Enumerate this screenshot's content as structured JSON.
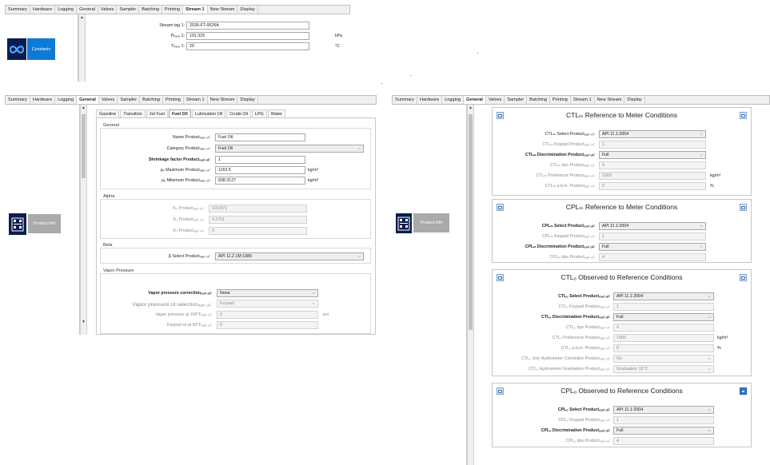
{
  "top": {
    "tabs": [
      "Summary",
      "Hardware",
      "Logging",
      "General",
      "Valves",
      "Sampler",
      "Batching",
      "Printing",
      "Stream 1",
      "New Stream",
      "Display"
    ],
    "active_tab": "Stream 1",
    "constants_label": "Constants",
    "fields": [
      {
        "label": "Stream tag 1:",
        "value": "2036-FT-0526A",
        "unit": ""
      },
      {
        "label": "Pₕₐₛₑ 1:",
        "value": "101.325",
        "unit": "kPa"
      },
      {
        "label": "Tₕₐₛₑ 1:",
        "value": "20",
        "unit": "°C"
      }
    ]
  },
  "left": {
    "tabs": [
      "Summary",
      "Hardware",
      "Logging",
      "General",
      "Valves",
      "Sampler",
      "Batching",
      "Printing",
      "Stream 1",
      "New Stream",
      "Display"
    ],
    "active_tab": "General",
    "product_info_label": "Product Info",
    "subtabs": [
      "Gasoline",
      "Transition",
      "Jet Fuel",
      "Fuel Oil",
      "Lubrication Oil",
      "Crude Oil",
      "LPG",
      "Water"
    ],
    "active_subtab": "Fuel Oil",
    "general": {
      "title": "General",
      "name_label": "Name Productₓₐₑₗ ₒᵢₗ:",
      "name_value": "Fuel Oil",
      "category_label": "Category Productₓₐₑₗ ₒᵢₗ:",
      "category_value": "Fuel Oil",
      "shrinkage_label": "Shrinkage factor Productₓₐₑₗ ₒᵢₗ:",
      "shrinkage_value": "1",
      "max_label": "ρₑ Maximum Productₓₐₑₗ ₒᵢₗ:",
      "max_value": "1163.5",
      "max_unit": "kg/m³",
      "min_label": "ρₑ Minimum Productₓₐₑₗ ₒᵢₗ:",
      "min_value": "838.3127",
      "min_unit": "kg/m³"
    },
    "alpha": {
      "title": "Alpha",
      "rows": [
        {
          "label": "K₀ Productₓₐₑₗ ₒᵢₗ:",
          "value": "103.872"
        },
        {
          "label": "K₁ Productₓₐₑₗ ₒᵢₗ:",
          "value": "0.2701"
        },
        {
          "label": "K₂ Productₓₐₑₗ ₒᵢₗ:",
          "value": "0"
        }
      ]
    },
    "beta": {
      "title": "Beta",
      "select_label": "β Select Productₓₐₑₗ ₒᵢₗ:",
      "select_value": "API 11.2.1M:1985"
    },
    "vapor": {
      "title": "Vapor Pressure",
      "correction_label": "Vapor pressure correctionₓₐₑₗ ₒᵢₗ:",
      "correction_value": "None",
      "rd_label": "Vapor pressure rd selectionₓₐₑₗ ₒᵢₗ:",
      "rd_value": "Keypad",
      "at100_label": "Vapor pressure at 100°Fₓₐₑₗ ₒᵢₗ:",
      "at100_value": "0",
      "at100_unit": "psi",
      "keypad_label": "Keypad rd at 60°Fₓₐₑₗ ₒᵢₗ:",
      "keypad_value": "0"
    }
  },
  "right": {
    "tabs": [
      "Summary",
      "Hardware",
      "Logging",
      "General",
      "Valves",
      "Sampler",
      "Batching",
      "Printing",
      "Stream 1",
      "New Stream",
      "Display"
    ],
    "active_tab": "General",
    "product_info_label": "Product Info",
    "cards": [
      {
        "title": "CTLₘ Reference to Meter Conditions",
        "rows": [
          {
            "label": "CTLₘ Select Productₓₐₑₗ ₒᵢₗ:",
            "value": "API 11.1:2004",
            "kind": "dd",
            "style": "normal",
            "unit": ""
          },
          {
            "label": "CTLₘ Keypad Productₓₐₑₗ ₒᵢₗ:",
            "value": "1",
            "kind": "fld",
            "style": "dim",
            "unit": ""
          },
          {
            "label": "CTLₘ Discrimination Productₓₐₑₗ ₒᵢₗ:",
            "value": "Full",
            "kind": "dd",
            "style": "bold",
            "unit": ""
          },
          {
            "label": "CTLₘ dps Productₓₐₑₗ ₒᵢₗ:",
            "value": "4",
            "kind": "fld",
            "style": "dim",
            "unit": ""
          },
          {
            "label": "CTLₘ Preference Productₓₐₑₗ ₒᵢₗ:",
            "value": "1000",
            "kind": "fld",
            "style": "dim",
            "unit": "kg/m³"
          },
          {
            "label": "CTLₘ a.b.m. Productₓₐₑₗ ₒᵢₗ:",
            "value": "0",
            "kind": "fld",
            "style": "dim",
            "unit": "%"
          }
        ]
      },
      {
        "title": "CPLₘ Reference to Meter Conditions",
        "rows": [
          {
            "label": "CPLₘ Select Productₓₐₑₗ ₒᵢₗ:",
            "value": "API 11.1:2004",
            "kind": "dd",
            "style": "bold",
            "unit": ""
          },
          {
            "label": "CPLₘ Keypad Productₓₐₑₗ ₒᵢₗ:",
            "value": "1",
            "kind": "fld",
            "style": "dim",
            "unit": ""
          },
          {
            "label": "CPLₘ Discrimination Productₓₐₑₗ ₒᵢₗ:",
            "value": "Full",
            "kind": "dd",
            "style": "bold",
            "unit": ""
          },
          {
            "label": "CPLₘ dps Productₓₐₑₗ ₒᵢₗ:",
            "value": "4",
            "kind": "fld",
            "style": "dim",
            "unit": ""
          }
        ]
      },
      {
        "title": "CTLₒ Observed to Reference Conditions",
        "rows": [
          {
            "label": "CTLₒ Select Productₓₐₑₗ ₒᵢₗ:",
            "value": "API 11.1:2004",
            "kind": "dd",
            "style": "bold",
            "unit": ""
          },
          {
            "label": "CTLₒ Keypad Productₓₐₑₗ ₒᵢₗ:",
            "value": "1",
            "kind": "fld",
            "style": "dim",
            "unit": ""
          },
          {
            "label": "CTLₒ Discrimination Productₓₐₑₗ ₒᵢₗ:",
            "value": "Full",
            "kind": "dd",
            "style": "bold",
            "unit": ""
          },
          {
            "label": "CTLₒ dps Productₓₐₑₗ ₒᵢₗ:",
            "value": "4",
            "kind": "fld",
            "style": "dim",
            "unit": ""
          },
          {
            "label": "CTLₒ Preference Productₓₐₑₗ ₒᵢₗ:",
            "value": "1000",
            "kind": "fld",
            "style": "dim",
            "unit": "kg/m³"
          },
          {
            "label": "CTLₒ a.b.m. Productₓₐₑₗ ₒᵢₗ:",
            "value": "0",
            "kind": "fld",
            "style": "dim",
            "unit": "%"
          },
          {
            "label": "CTLₒ Use Hydrometer Correction Productₓₐₑₗ ₒᵢₗ:",
            "value": "No",
            "kind": "dd",
            "style": "dim",
            "unit": ""
          },
          {
            "label": "CTLₒ Hydrometer Graduation Productₓₐₑₗ ₒᵢₗ:",
            "value": "Graduation 15°C",
            "kind": "dd",
            "style": "dim",
            "unit": ""
          }
        ]
      },
      {
        "title": "CPLₒ Observed to Reference Conditions",
        "rows": [
          {
            "label": "CPLₒ Select Productₓₐₑₗ ₒᵢₗ:",
            "value": "API 11.1:2004",
            "kind": "dd",
            "style": "bold",
            "unit": ""
          },
          {
            "label": "CPLₒ Keypad Productₓₐₑₗ ₒᵢₗ:",
            "value": "1",
            "kind": "fld",
            "style": "dim",
            "unit": ""
          },
          {
            "label": "CPLₒ Discrimination Productₓₐₑₗ ₒᵢₗ:",
            "value": "Full",
            "kind": "dd",
            "style": "bold",
            "unit": ""
          },
          {
            "label": "CPLₒ dps Productₓₐₑₗ ₒᵢₗ:",
            "value": "4",
            "kind": "fld",
            "style": "dim",
            "unit": ""
          }
        ]
      }
    ]
  },
  "colors": {
    "accent_blue": "#0d7bd6",
    "icon_navy": "#0a1d4d",
    "disabled_button": "#aaaaaa"
  },
  "icons": {
    "constants": "infinity-icon",
    "product_info": "device-grid-icon",
    "card_action": "window-icon"
  }
}
